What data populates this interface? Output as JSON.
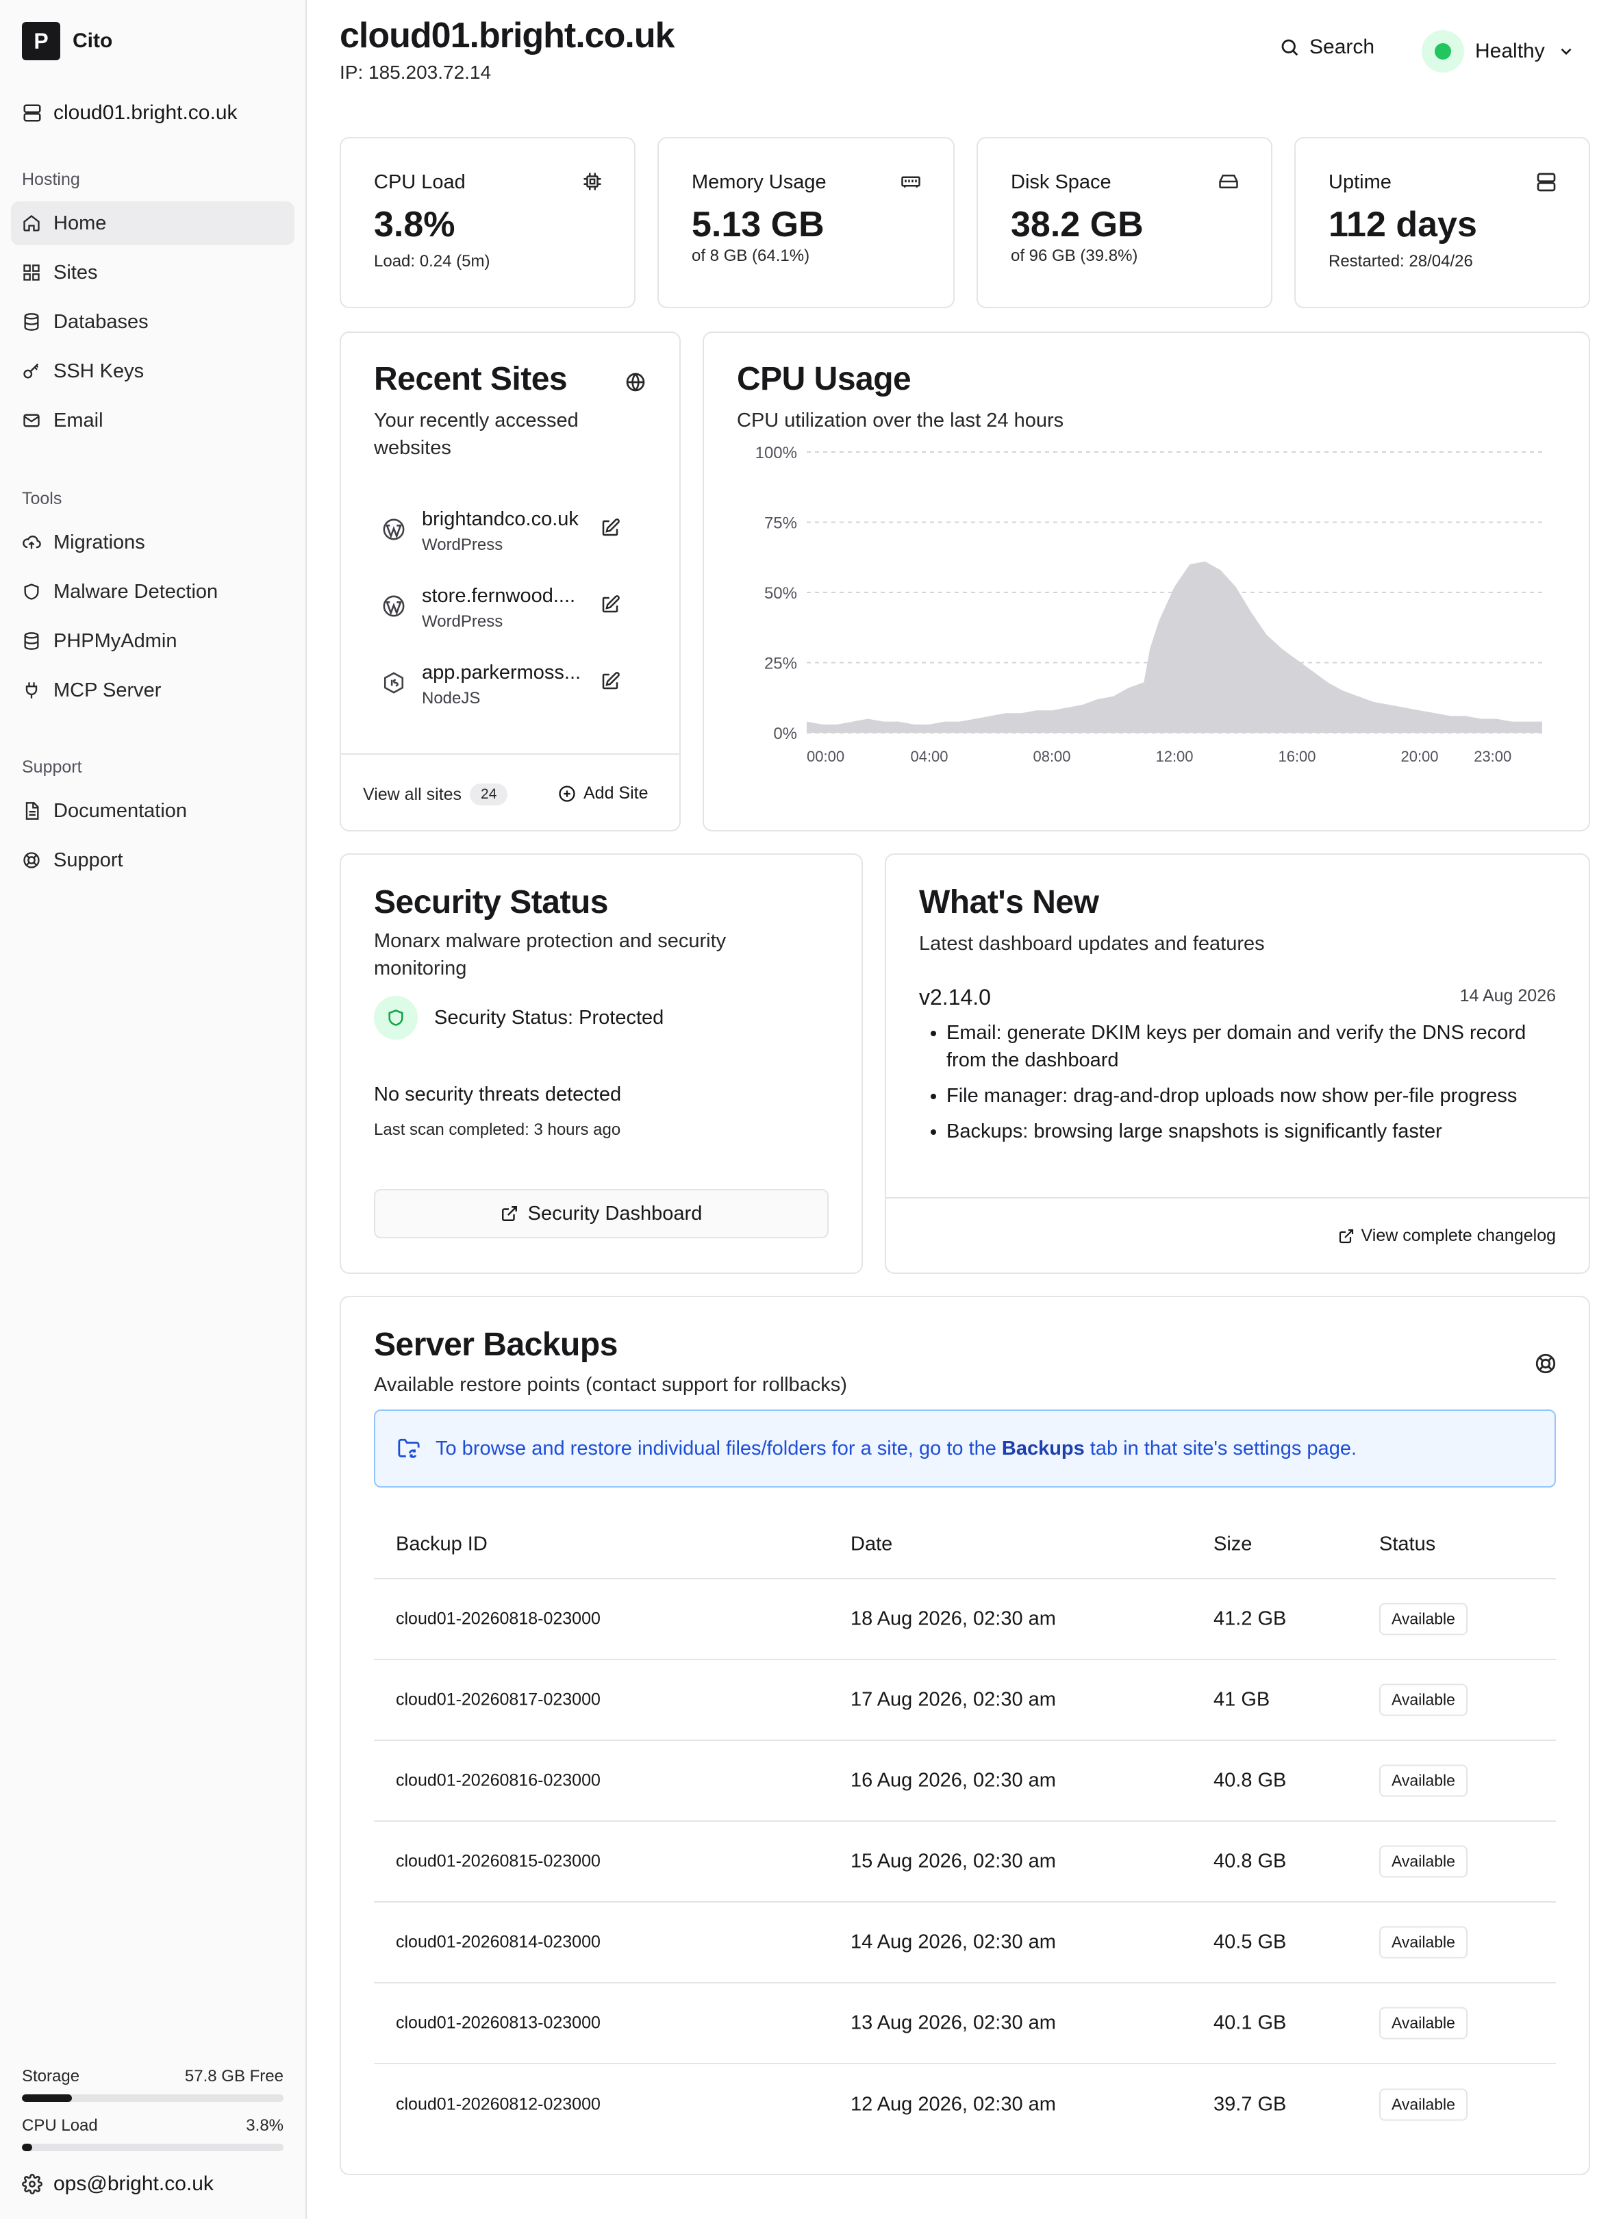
{
  "brand": {
    "name": "Cito",
    "logo_letter": "P"
  },
  "server": {
    "name": "cloud01.bright.co.uk"
  },
  "nav": {
    "hosting_label": "Hosting",
    "hosting": [
      {
        "label": "Home",
        "icon": "home-icon",
        "active": true
      },
      {
        "label": "Sites",
        "icon": "grid-icon"
      },
      {
        "label": "Databases",
        "icon": "database-icon"
      },
      {
        "label": "SSH Keys",
        "icon": "key-icon"
      },
      {
        "label": "Email",
        "icon": "mail-icon"
      }
    ],
    "tools_label": "Tools",
    "tools": [
      {
        "label": "Migrations",
        "icon": "cloud-upload-icon"
      },
      {
        "label": "Malware Detection",
        "icon": "shield-icon"
      },
      {
        "label": "PHPMyAdmin",
        "icon": "database-icon"
      },
      {
        "label": "MCP Server",
        "icon": "plug-icon"
      }
    ],
    "support_label": "Support",
    "support": [
      {
        "label": "Documentation",
        "icon": "document-icon"
      },
      {
        "label": "Support",
        "icon": "lifebuoy-icon"
      }
    ]
  },
  "sidebar_meters": {
    "storage": {
      "label": "Storage",
      "value": "57.8 GB Free",
      "fraction": 0.19
    },
    "cpu": {
      "label": "CPU Load",
      "value": "3.8%",
      "fraction": 0.038
    }
  },
  "user": {
    "email": "ops@bright.co.uk"
  },
  "header": {
    "title": "cloud01.bright.co.uk",
    "ip": "IP: 185.203.72.14",
    "search_label": "Search",
    "health_label": "Healthy",
    "health_color": "#22c55e"
  },
  "stats": [
    {
      "label": "CPU Load",
      "value": "3.8%",
      "sub": "Load: 0.24 (5m)",
      "icon": "cpu-chip-icon"
    },
    {
      "label": "Memory Usage",
      "value": "5.13 GB",
      "sub": "of 8 GB (64.1%)",
      "icon": "memory-icon"
    },
    {
      "label": "Disk Space",
      "value": "38.2 GB",
      "sub": "of 96 GB (39.8%)",
      "icon": "hard-drive-icon"
    },
    {
      "label": "Uptime",
      "value": "112 days",
      "sub": "Restarted: 28/04/26",
      "icon": "server-icon"
    }
  ],
  "recent_sites": {
    "title": "Recent Sites",
    "description": "Your recently accessed websites",
    "sites": [
      {
        "name": "brightandco.co.uk",
        "type": "WordPress",
        "icon": "wordpress-icon"
      },
      {
        "name": "store.fernwood....",
        "type": "WordPress",
        "icon": "wordpress-icon"
      },
      {
        "name": "app.parkermoss...",
        "type": "NodeJS",
        "icon": "nodejs-icon"
      }
    ],
    "view_all_label": "View all sites",
    "count": "24",
    "add_label": "Add Site"
  },
  "cpu_usage": {
    "title": "CPU Usage",
    "description": "CPU utilization over the last 24 hours"
  },
  "chart_data": {
    "type": "area",
    "y_ticks": [
      "100%",
      "75%",
      "50%",
      "25%",
      "0%"
    ],
    "x_ticks": [
      "00:00",
      "04:00",
      "08:00",
      "12:00",
      "16:00",
      "20:00",
      "23:00"
    ],
    "ylim": [
      0,
      100
    ],
    "xlim": [
      0,
      24
    ],
    "grid": true,
    "fill_color": "#d4d4d8",
    "x": [
      0,
      0.5,
      1,
      1.5,
      2,
      2.5,
      3,
      3.5,
      4,
      4.5,
      5,
      5.5,
      6,
      6.5,
      7,
      7.5,
      8,
      8.5,
      9,
      9.5,
      10,
      10.5,
      11,
      11.2,
      11.5,
      12,
      12.5,
      13,
      13.5,
      14,
      14.5,
      15,
      15.5,
      16,
      16.5,
      17,
      17.5,
      18,
      18.5,
      19,
      19.5,
      20,
      20.5,
      21,
      21.5,
      22,
      22.5,
      23,
      24
    ],
    "values": [
      4,
      3,
      3,
      4,
      5,
      4,
      4,
      3,
      3,
      4,
      4,
      5,
      6,
      7,
      7,
      8,
      8,
      9,
      10,
      12,
      13,
      16,
      18,
      30,
      40,
      52,
      60,
      61,
      58,
      52,
      43,
      35,
      30,
      26,
      22,
      18,
      15,
      13,
      11,
      10,
      9,
      8,
      7,
      6,
      6,
      5,
      5,
      4,
      4
    ]
  },
  "security": {
    "title": "Security Status",
    "description": "Monarx malware protection and security monitoring",
    "status_label": "Security Status: Protected",
    "threats": "No security threats detected",
    "last_scan": "Last scan completed: 3 hours ago",
    "button_label": "Security Dashboard"
  },
  "whats_new": {
    "title": "What's New",
    "description": "Latest dashboard updates and features",
    "version": "v2.14.0",
    "date": "14 Aug 2026",
    "items": [
      "Email: generate DKIM keys per domain and verify the DNS record from the dashboard",
      "File manager: drag-and-drop uploads now show per-file progress",
      "Backups: browsing large snapshots is significantly faster"
    ],
    "changelog_label": "View complete changelog"
  },
  "backups": {
    "title": "Server Backups",
    "description": "Available restore points (contact support for rollbacks)",
    "info_prefix": "To browse and restore individual files/folders for a site, go to the",
    "info_bold": "Backups",
    "info_suffix": "tab in that site's settings page.",
    "columns": [
      "Backup ID",
      "Date",
      "Size",
      "Status"
    ],
    "rows": [
      {
        "id": "cloud01-20260818-023000",
        "date": "18 Aug 2026, 02:30 am",
        "size": "41.2 GB",
        "status": "Available"
      },
      {
        "id": "cloud01-20260817-023000",
        "date": "17 Aug 2026, 02:30 am",
        "size": "41 GB",
        "status": "Available"
      },
      {
        "id": "cloud01-20260816-023000",
        "date": "16 Aug 2026, 02:30 am",
        "size": "40.8 GB",
        "status": "Available"
      },
      {
        "id": "cloud01-20260815-023000",
        "date": "15 Aug 2026, 02:30 am",
        "size": "40.8 GB",
        "status": "Available"
      },
      {
        "id": "cloud01-20260814-023000",
        "date": "14 Aug 2026, 02:30 am",
        "size": "40.5 GB",
        "status": "Available"
      },
      {
        "id": "cloud01-20260813-023000",
        "date": "13 Aug 2026, 02:30 am",
        "size": "40.1 GB",
        "status": "Available"
      },
      {
        "id": "cloud01-20260812-023000",
        "date": "12 Aug 2026, 02:30 am",
        "size": "39.7 GB",
        "status": "Available"
      }
    ]
  }
}
